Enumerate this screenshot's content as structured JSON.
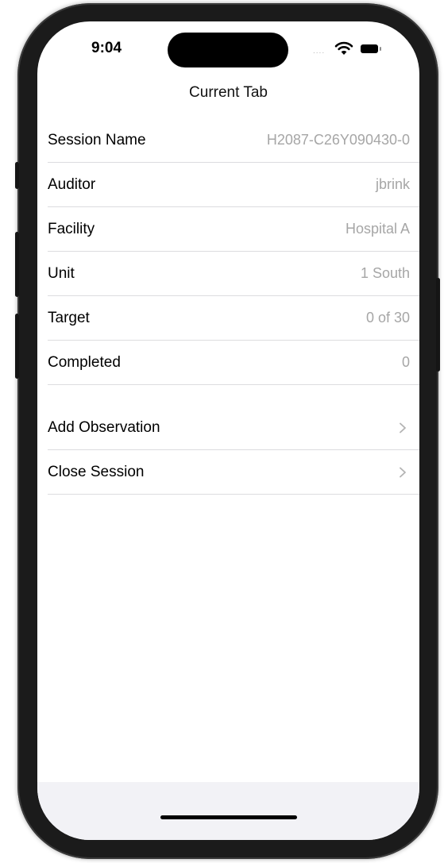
{
  "status_bar": {
    "time": "9:04",
    "signal_text": "....",
    "icons": [
      "wifi-icon",
      "battery-icon"
    ]
  },
  "nav": {
    "title": "Current Tab"
  },
  "details": [
    {
      "label": "Session Name",
      "value": "H2087-C26Y090430-0"
    },
    {
      "label": "Auditor",
      "value": "jbrink"
    },
    {
      "label": "Facility",
      "value": "Hospital A"
    },
    {
      "label": "Unit",
      "value": "1 South"
    },
    {
      "label": "Target",
      "value": "0 of 30"
    },
    {
      "label": "Completed",
      "value": "0"
    }
  ],
  "actions": [
    {
      "label": "Add Observation",
      "icon": "chevron-right-icon"
    },
    {
      "label": "Close Session",
      "icon": "chevron-right-icon"
    }
  ],
  "colors": {
    "frame": "#1b1b1b",
    "value_text": "#a6a6a6",
    "separator": "#dcdcdf",
    "bottom_bar": "#f2f2f6"
  }
}
